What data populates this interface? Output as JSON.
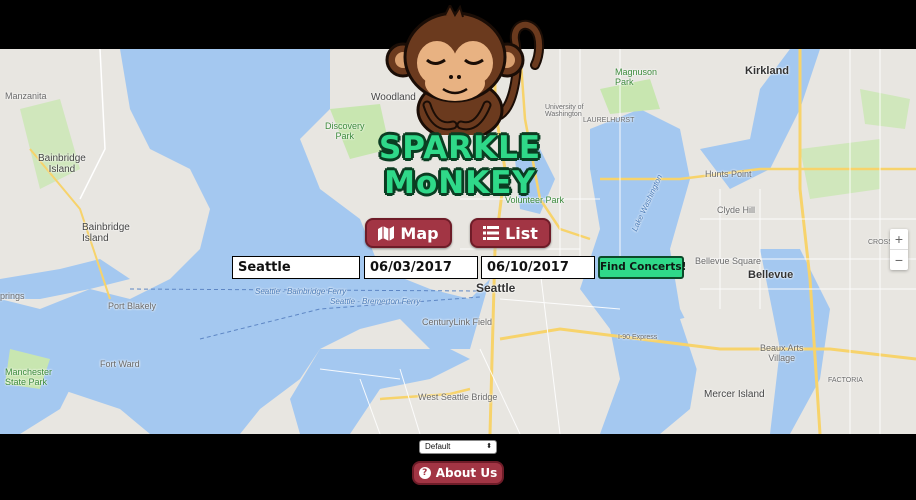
{
  "app": {
    "name_line1": "SPARKLE",
    "name_line2": "MoNKEY"
  },
  "nav": {
    "map_label": "Map",
    "list_label": "List",
    "map_icon": "map-icon",
    "list_icon": "list-icon"
  },
  "search": {
    "city_value": "Seattle",
    "from_date_value": "06/03/2017",
    "to_date_value": "06/10/2017",
    "submit_label": "Find Concerts!"
  },
  "map": {
    "labels": {
      "manzanita": "Manzanita",
      "bainbridge": "Bainbridge\nIsland",
      "port_blakely": "Port Blakely",
      "fort_ward": "Fort Ward",
      "manchester": "Manchester\nState Park",
      "woodland": "Woodland",
      "discovery": "Discovery\nPark",
      "seattle": "Seattle",
      "centurylink": "CenturyLink Field",
      "kirkland": "Kirkland",
      "bellevue": "Bellevue",
      "bellevue_sq": "Bellevue Square",
      "clyde_hill": "Clyde Hill",
      "hunts_point": "Hunts Point",
      "mercer": "Mercer Island",
      "beaux_arts": "Beaux Arts\nVillage",
      "west_seattle": "West Seattle Bridge",
      "volunteer": "Volunteer Park",
      "laurelhurst": "LAURELHURST",
      "magnuson": "Magnuson\nPark",
      "lake_wa": "Lake Washington",
      "ferry1": "Seattle - Bainbridge Ferry",
      "ferry2": "Seattle - Bremerton Ferry",
      "uw": "University of\nWashington",
      "i90": "I-90 Express",
      "factoria": "FACTORIA",
      "springs": "prings",
      "crossroads": "CROSS"
    },
    "zoom_in": "+",
    "zoom_out": "−"
  },
  "footer": {
    "sort_value": "Default",
    "about_label": "About Us"
  },
  "colors": {
    "accent_red": "#a23544",
    "accent_green": "#2fd989",
    "water": "#a4c8f0",
    "land": "#e8e6e1",
    "park": "#c8e6b0"
  }
}
